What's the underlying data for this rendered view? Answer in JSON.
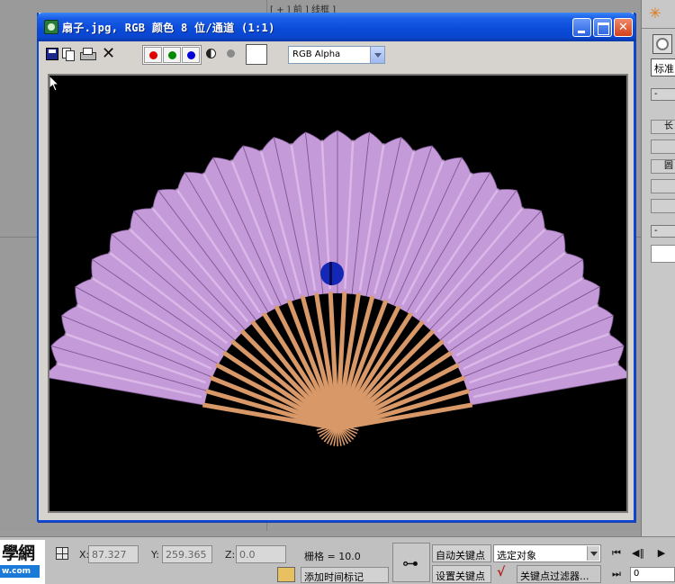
{
  "viewport": {
    "label": "[ + ] 前 ] 线框 ]"
  },
  "command_panel": {
    "dropdown_value": "标准",
    "rollout_1": "-",
    "rollout_2": "-",
    "button_1": "长",
    "button_2": "圆"
  },
  "image_window": {
    "title": "扇子.jpg, RGB 颜色 8 位/通道 (1:1)",
    "channel_select_value": "RGB Alpha",
    "channel_colors": {
      "red": "#e00000",
      "green": "#008a00",
      "blue": "#0000d8"
    },
    "image_colors": {
      "fabric": "#c49ad8",
      "ribs": "#d89868",
      "background": "#000000"
    },
    "icons": [
      "save-icon",
      "copy-icon",
      "print-icon",
      "clear-icon",
      "monochrome-icon",
      "alpha-icon"
    ]
  },
  "status_bar": {
    "logo_text": "學網",
    "logo_url": "w.com",
    "x_label": "X:",
    "x_value": "87.327",
    "y_label": "Y:",
    "y_value": "259.365",
    "z_label": "Z:",
    "z_value": "0.0",
    "grid_text": "栅格 = 10.0",
    "auto_key": "自动关键点",
    "set_key": "设置关键点",
    "selection_select": "选定对象",
    "add_time_tag": "添加时间标记",
    "key_filters": "关键点过滤器...",
    "frame_value": "0"
  }
}
